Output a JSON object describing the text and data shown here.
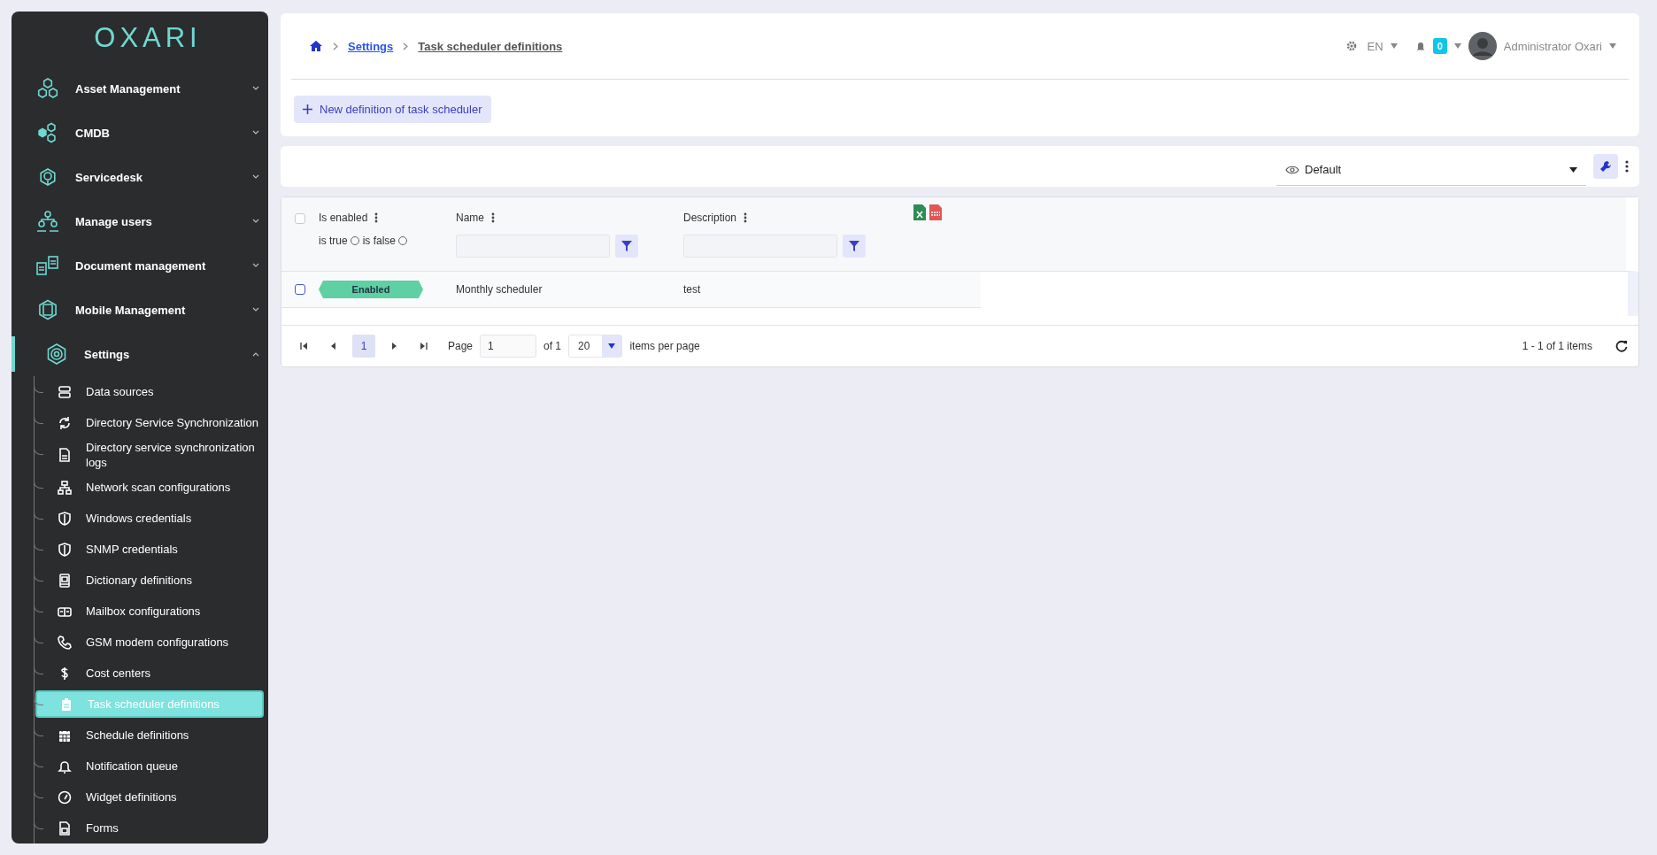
{
  "logo": "OXARI",
  "sidebar": {
    "sections": [
      {
        "label": "Asset Management",
        "expanded": false
      },
      {
        "label": "CMDB",
        "expanded": false
      },
      {
        "label": "Servicedesk",
        "expanded": false
      },
      {
        "label": "Manage users",
        "expanded": false
      },
      {
        "label": "Document management",
        "expanded": false
      },
      {
        "label": "Mobile Management",
        "expanded": false
      },
      {
        "label": "Settings",
        "expanded": true,
        "children": [
          {
            "label": "Data sources",
            "selected": false
          },
          {
            "label": "Directory Service Synchronization",
            "selected": false
          },
          {
            "label": "Directory service synchronization logs",
            "selected": false
          },
          {
            "label": "Network scan configurations",
            "selected": false
          },
          {
            "label": "Windows credentials",
            "selected": false
          },
          {
            "label": "SNMP credentials",
            "selected": false
          },
          {
            "label": "Dictionary definitions",
            "selected": false
          },
          {
            "label": "Mailbox configurations",
            "selected": false
          },
          {
            "label": "GSM modem configurations",
            "selected": false
          },
          {
            "label": "Cost centers",
            "selected": false
          },
          {
            "label": "Task scheduler definitions",
            "selected": true
          },
          {
            "label": "Schedule definitions",
            "selected": false
          },
          {
            "label": "Notification queue",
            "selected": false
          },
          {
            "label": "Widget definitions",
            "selected": false
          },
          {
            "label": "Forms",
            "selected": false
          }
        ]
      }
    ]
  },
  "breadcrumb": [
    "Settings",
    "Task scheduler definitions"
  ],
  "header": {
    "language": "EN",
    "notification_count": "0",
    "user": "Administrator Oxari"
  },
  "new_button": "New definition of task scheduler",
  "view_select": {
    "value": "Default"
  },
  "table": {
    "select_all_checked": false,
    "columns": [
      "Is enabled",
      "Name",
      "Description"
    ],
    "filter_options": [
      {
        "label": "is true",
        "selected": false
      },
      {
        "label": "is false",
        "selected": false
      }
    ],
    "rows": [
      {
        "checked": false,
        "enabled": true,
        "status_label": "Enabled",
        "name": "Monthly scheduler",
        "description": "test"
      }
    ]
  },
  "pagination": {
    "current_page": "1",
    "page_label": "Page",
    "page_value": "1",
    "of": "of 1",
    "page_size": "20",
    "per_page": "items per page",
    "summary": "1 - 1 of 1 items"
  }
}
